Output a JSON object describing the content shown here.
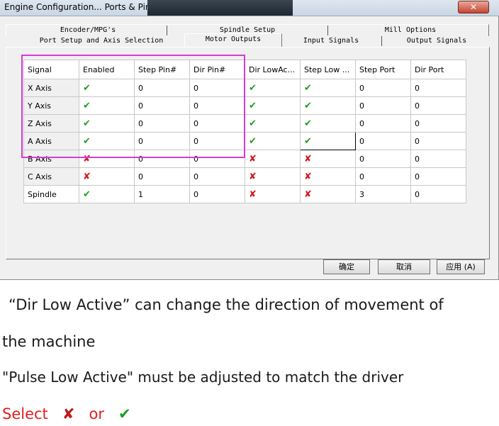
{
  "window": {
    "title": "Engine Configuration... Ports & Pins",
    "close_label": "✕"
  },
  "tabs_back": [
    "Encoder/MPG's",
    "Spindle Setup",
    "Mill Options"
  ],
  "tabs_front": [
    "Port Setup and Axis Selection",
    "Motor Outputs",
    "Input Signals",
    "Output Signals"
  ],
  "active_tab": "Motor Outputs",
  "grid": {
    "columns": [
      "Signal",
      "Enabled",
      "Step Pin#",
      "Dir Pin#",
      "Dir LowAc...",
      "Step Low ...",
      "Step Port",
      "Dir Port"
    ],
    "rows": [
      {
        "signal": "X Axis",
        "enabled": "✔",
        "step_pin": "0",
        "dir_pin": "0",
        "dir_low": "✔",
        "step_low": "✔",
        "step_port": "0",
        "dir_port": "0"
      },
      {
        "signal": "Y Axis",
        "enabled": "✔",
        "step_pin": "0",
        "dir_pin": "0",
        "dir_low": "✔",
        "step_low": "✔",
        "step_port": "0",
        "dir_port": "0"
      },
      {
        "signal": "Z Axis",
        "enabled": "✔",
        "step_pin": "0",
        "dir_pin": "0",
        "dir_low": "✔",
        "step_low": "✔",
        "step_port": "0",
        "dir_port": "0"
      },
      {
        "signal": "A Axis",
        "enabled": "✔",
        "step_pin": "0",
        "dir_pin": "0",
        "dir_low": "✔",
        "step_low": "✔",
        "step_port": "0",
        "dir_port": "0"
      },
      {
        "signal": "B Axis",
        "enabled": "✘",
        "step_pin": "0",
        "dir_pin": "0",
        "dir_low": "✘",
        "step_low": "✘",
        "step_port": "0",
        "dir_port": "0"
      },
      {
        "signal": "C Axis",
        "enabled": "✘",
        "step_pin": "0",
        "dir_pin": "0",
        "dir_low": "✘",
        "step_low": "✘",
        "step_port": "0",
        "dir_port": "0"
      },
      {
        "signal": "Spindle",
        "enabled": "✔",
        "step_pin": "1",
        "dir_pin": "0",
        "dir_low": "✘",
        "step_low": "✘",
        "step_port": "3",
        "dir_port": "0"
      }
    ]
  },
  "buttons": {
    "ok": "确定",
    "cancel": "取消",
    "apply": "应用",
    "apply_key": "(A)"
  },
  "captions": {
    "line1": "“Dir Low Active”   can change the direction of movement of",
    "line2": "the machine",
    "line3": "\"Pulse Low Active\" must be adjusted to match the driver",
    "line4_select": "Select",
    "line4_or": "or",
    "cross_glyph": "✘",
    "check_glyph": "✔"
  },
  "colors": {
    "highlight": "#d43cd4",
    "check": "#1f9c1f",
    "cross": "#d21a1a",
    "select_text": "#e02020"
  }
}
